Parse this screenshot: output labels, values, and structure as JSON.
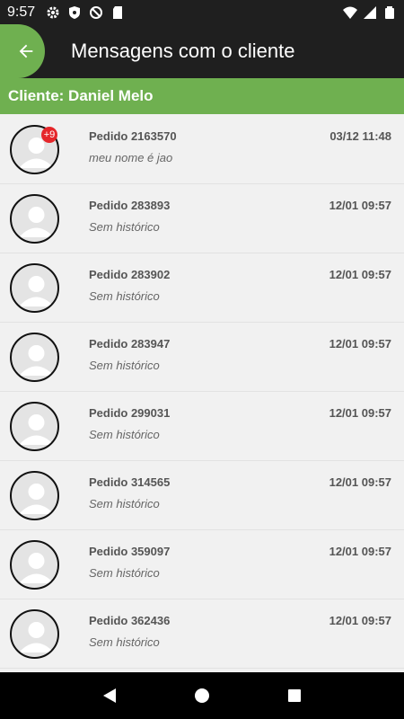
{
  "status_bar": {
    "time": "9:57",
    "icons_left": [
      "gear-icon",
      "shield-icon",
      "blocked-icon",
      "sd-card-icon"
    ],
    "icons_right": [
      "wifi-icon",
      "signal-icon",
      "battery-icon"
    ]
  },
  "app_bar": {
    "back_icon": "arrow-left-icon",
    "title": "Mensagens com o cliente"
  },
  "client_bar": {
    "label": "Cliente: Daniel Melo"
  },
  "messages": [
    {
      "order": "Pedido 2163570",
      "date": "03/12 11:48",
      "snippet": "meu nome é jao",
      "badge": "+9"
    },
    {
      "order": "Pedido 283893",
      "date": "12/01 09:57",
      "snippet": "Sem histórico",
      "badge": ""
    },
    {
      "order": "Pedido 283902",
      "date": "12/01 09:57",
      "snippet": "Sem histórico",
      "badge": ""
    },
    {
      "order": "Pedido 283947",
      "date": "12/01 09:57",
      "snippet": "Sem histórico",
      "badge": ""
    },
    {
      "order": "Pedido 299031",
      "date": "12/01 09:57",
      "snippet": "Sem histórico",
      "badge": ""
    },
    {
      "order": "Pedido 314565",
      "date": "12/01 09:57",
      "snippet": "Sem histórico",
      "badge": ""
    },
    {
      "order": "Pedido 359097",
      "date": "12/01 09:57",
      "snippet": "Sem histórico",
      "badge": ""
    },
    {
      "order": "Pedido 362436",
      "date": "12/01 09:57",
      "snippet": "Sem histórico",
      "badge": ""
    }
  ],
  "colors": {
    "accent": "#6fb050",
    "app_bar": "#1f1f1f",
    "badge": "#e5262a"
  },
  "nav_bar": {
    "icons": [
      "back-triangle-icon",
      "home-circle-icon",
      "recents-square-icon"
    ]
  }
}
